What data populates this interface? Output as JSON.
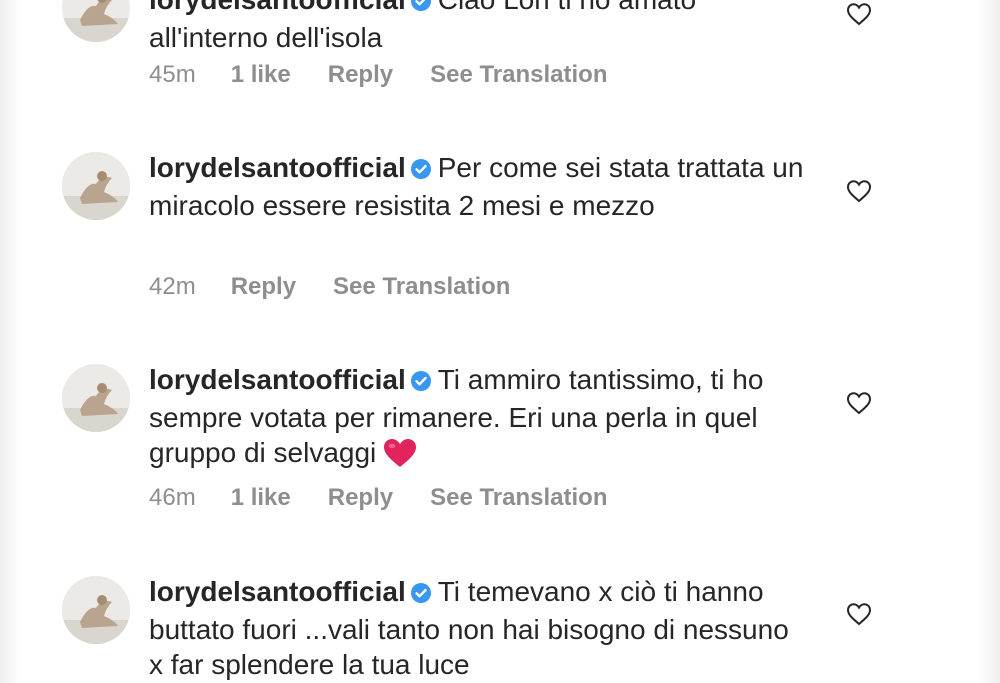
{
  "comments": [
    {
      "username": "lorydelsantoofficial",
      "text": "Ciao Lori ti ho amato",
      "text_line2": "all'interno dell'isola",
      "time": "45m",
      "likes": "1 like",
      "reply": "Reply",
      "translate": "See Translation"
    },
    {
      "username": "lorydelsantoofficial",
      "text": "Per come sei stata trattata un miracolo essere resistita 2 mesi e mezzo",
      "time": "42m",
      "reply": "Reply",
      "translate": "See Translation"
    },
    {
      "username": "lorydelsantoofficial",
      "text": "Ti ammiro tantissimo, ti ho sempre votata per rimanere. Eri una perla in quel gruppo di selvaggi",
      "time": "46m",
      "likes": "1 like",
      "reply": "Reply",
      "translate": "See Translation"
    },
    {
      "username": "lorydelsantoofficial",
      "text": "Ti temevano x ciò ti hanno buttato fuori ...vali tanto non hai bisogno di nessuno x far splendere la tua luce"
    }
  ],
  "icons": {
    "verified": "verified-badge-icon",
    "like": "heart-outline-icon",
    "emoji": "red-heart-emoji"
  },
  "colors": {
    "text": "#262626",
    "meta": "#8e8e8e",
    "verified": "#3897f0",
    "heart_emoji": "#e0245e",
    "like_outline": "#262626"
  }
}
